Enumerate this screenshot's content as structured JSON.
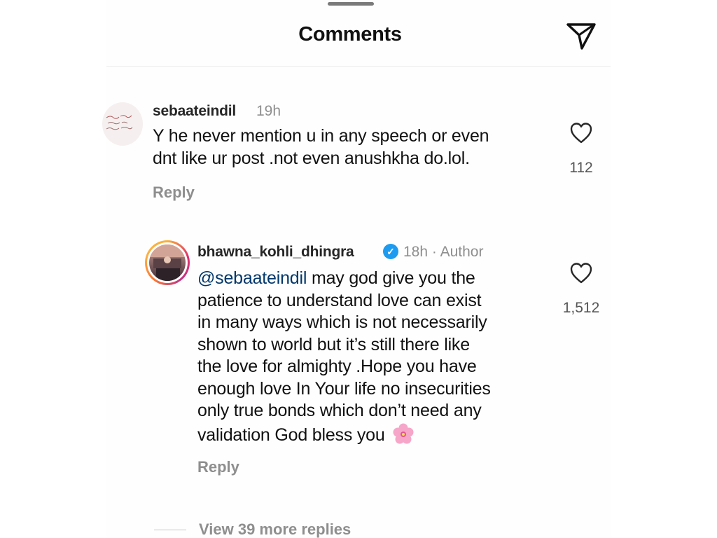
{
  "header": {
    "title": "Comments",
    "share_icon": "paper-plane-icon"
  },
  "comments": [
    {
      "username": "sebaateindil",
      "time": "19h",
      "lines": [
        "Y he never mention u in any speech or even",
        "dnt like ur post .not even anushkha do.lol."
      ],
      "likes": "112",
      "reply_label": "Reply",
      "avatar_icon": "handwriting-avatar-icon",
      "like_icon": "heart-outline-icon"
    }
  ],
  "reply": {
    "username": "bhawna_kohli_dhingra",
    "verified_icon": "verified-badge-icon",
    "time": "18h",
    "separator": "·",
    "author_label": "Author",
    "mention": "@sebaateindil",
    "line_1_rest": "may god give you the",
    "lines": [
      "patience to understand love can exist",
      "in many ways which is not necessarily",
      "shown to world but it’s still there like",
      "the love for almighty .Hope  you have",
      "enough love In Your life no insecurities",
      "only true bonds which don’t need any"
    ],
    "last_line": "validation God bless you",
    "emoji_icon": "cherry-blossom-icon",
    "likes": "1,512",
    "reply_label": "Reply",
    "like_icon": "heart-outline-icon"
  },
  "view_more": {
    "label": "View 39 more replies"
  },
  "colors": {
    "text": "#111111",
    "secondary": "#8e8e8e",
    "mention": "#00376b",
    "verified": "#1d9bf0"
  }
}
